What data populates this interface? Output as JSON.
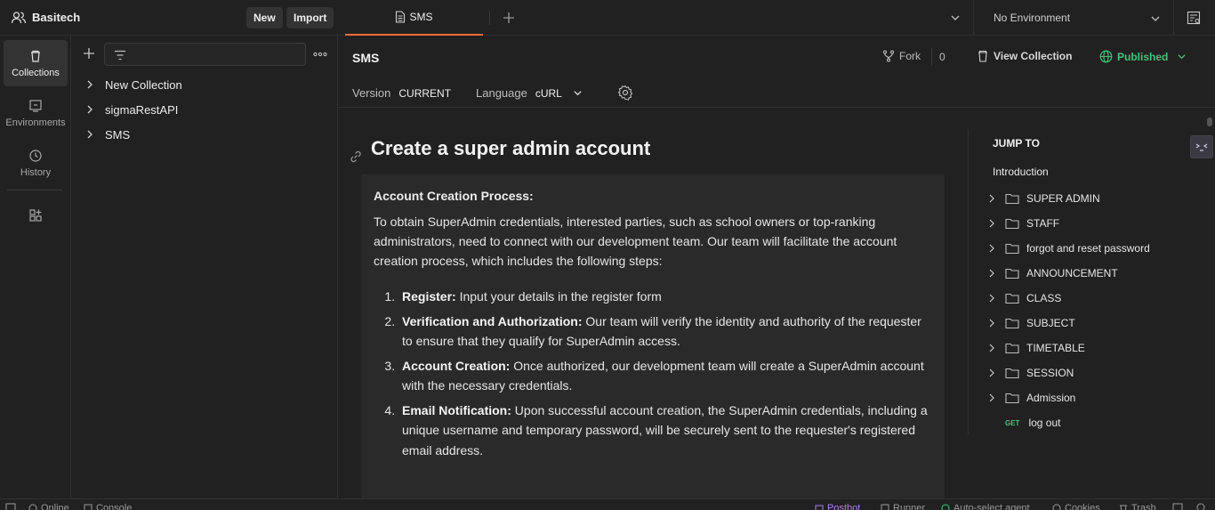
{
  "workspace": {
    "name": "Basitech",
    "new_label": "New",
    "import_label": "Import"
  },
  "rail": {
    "collections": "Collections",
    "environments": "Environments",
    "history": "History"
  },
  "sidebar": {
    "collections": [
      {
        "label": "New Collection"
      },
      {
        "label": "sigmaRestAPI"
      },
      {
        "label": "SMS"
      }
    ]
  },
  "tabs": [
    {
      "label": "SMS"
    }
  ],
  "environment": {
    "selected": "No Environment"
  },
  "header": {
    "title": "SMS",
    "fork_label": "Fork",
    "fork_count": "0",
    "view_collection_label": "View Collection",
    "published_label": "Published",
    "version_label": "Version",
    "version_value": "CURRENT",
    "language_label": "Language",
    "language_value": "cURL"
  },
  "doc": {
    "title": "Create a super admin account",
    "heading": "Account Creation Process:",
    "intro": "To obtain SuperAdmin credentials, interested parties, such as school owners or top-ranking administrators, need to connect with our development team. Our team will facilitate the account creation process, which includes the following steps:",
    "steps": [
      {
        "title": "Register:",
        "text": " Input your details in the register form"
      },
      {
        "title": "Verification and Authorization:",
        "text": " Our team will verify the identity and authority of the requester to ensure that they qualify for SuperAdmin access."
      },
      {
        "title": "Account Creation:",
        "text": " Once authorized, our development team will create a SuperAdmin account with the necessary credentials."
      },
      {
        "title": "Email Notification:",
        "text": " Upon successful account creation, the SuperAdmin credentials, including a unique username and temporary password, will be securely sent to the requester's registered email address."
      }
    ]
  },
  "jump_to": {
    "title": "JUMP TO",
    "intro": "Introduction",
    "folders": [
      "SUPER ADMIN",
      "STAFF",
      "forgot and reset password",
      "ANNOUNCEMENT",
      "CLASS",
      "SUBJECT",
      "TIMETABLE",
      "SESSION",
      "Admission"
    ],
    "request": {
      "method": "GET",
      "label": "log out"
    }
  },
  "statusbar": {
    "online": "Online",
    "console": "Console",
    "postbot": "Postbot",
    "runner": "Runner",
    "agent": "Auto-select agent",
    "cookies": "Cookies",
    "trash": "Trash"
  },
  "colors": {
    "accent": "#ff6c37",
    "published": "#47c27a",
    "background": "#212121",
    "doc_box": "#2a2a2a"
  }
}
